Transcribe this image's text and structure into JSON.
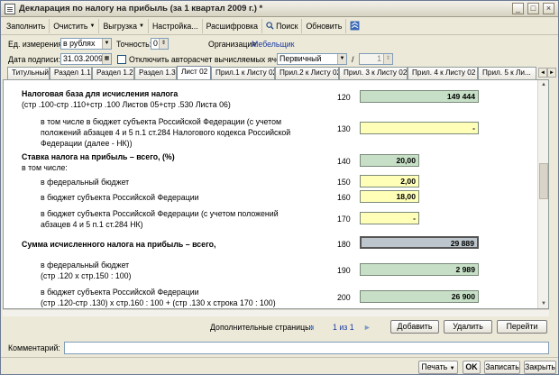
{
  "window": {
    "title": "Декларация по налогу на прибыль (за 1 квартал 2009 г.) *",
    "controls": [
      "_",
      "□",
      "×"
    ]
  },
  "toolbar": {
    "fill": "Заполнить",
    "clear": "Очистить",
    "upload": "Выгрузка",
    "setup": "Настройка...",
    "decode": "Расшифровка",
    "search": "Поиск",
    "refresh": "Обновить"
  },
  "form": {
    "unit_label": "Ед. измерения:",
    "unit_value": "в рублях",
    "precision_label": "Точность:",
    "precision_value": "0",
    "org_label": "Организация:",
    "org_value": "Мебельщик",
    "sign_date_label": "Дата подписи:",
    "sign_date_value": "31.03.2009",
    "disable_autocalc_label": "Отключить авторасчет вычисляемых ячеек",
    "doc_type_value": "Первичный",
    "correction_sep": "/",
    "correction_value": "1"
  },
  "tabs": [
    "Титульный",
    "Раздел 1.1",
    "Раздел 1.2",
    "Раздел 1.3",
    "Лист 02",
    "Прил.1 к Листу 02",
    "Прил.2 к Листу 02",
    "Прил. 3 к Листу 02",
    "Прил. 4 к Листу 02",
    "Прил. 5 к Ли..."
  ],
  "rows": {
    "r120_title": "Налоговая база для исчисления налога",
    "r120_formula": "(стр .100-стр .110+стр .100 Листов 05+стр .530 Листа 06)",
    "r120_code": "120",
    "r120_value": "149 444",
    "r130_l1": "в том числе в бюджет субъекта Российской Федерации (с учетом",
    "r130_l2": "положений абзацев 4 и 5 п.1 ст.284 Налогового кодекса Российской",
    "r130_l3": "Федерации (далее - НК))",
    "r130_code": "130",
    "r130_value": "-",
    "r140_title": "Ставка налога на прибыль – всего, (%)",
    "r140_sub": "в том числе:",
    "r140_code": "140",
    "r140_value": "20,00",
    "r150_label": "в федеральный бюджет",
    "r150_code": "150",
    "r150_value": "2,00",
    "r160_label": "в бюджет субъекта Российской Федерации",
    "r160_code": "160",
    "r160_value": "18,00",
    "r170_l1": "в бюджет субъекта Российской Федерации (с учетом положений",
    "r170_l2": "абзацев 4 и 5 п.1 ст.284 НК)",
    "r170_code": "170",
    "r170_value": "-",
    "r180_title": "Сумма исчисленного налога на прибыль – всего,",
    "r180_code": "180",
    "r180_value": "29 889",
    "r190_l1": "в федеральный бюджет",
    "r190_l2": "(стр .120 х стр.150 : 100)",
    "r190_code": "190",
    "r190_value": "2 989",
    "r200_l1": "в бюджет субъекта Российской Федерации",
    "r200_l2": "(стр .120-стр .130) х стр.160 : 100 + (стр .130 х строка 170 : 100)",
    "r200_code": "200",
    "r200_value": "26 900"
  },
  "pages": {
    "label": "Дополнительные страницы:",
    "counter": "1 из 1",
    "add": "Добавить",
    "delete": "Удалить",
    "goto": "Перейти"
  },
  "comment_label": "Комментарий:",
  "status": {
    "print": "Печать",
    "ok": "OK",
    "save": "Записать",
    "close": "Закрыть"
  }
}
